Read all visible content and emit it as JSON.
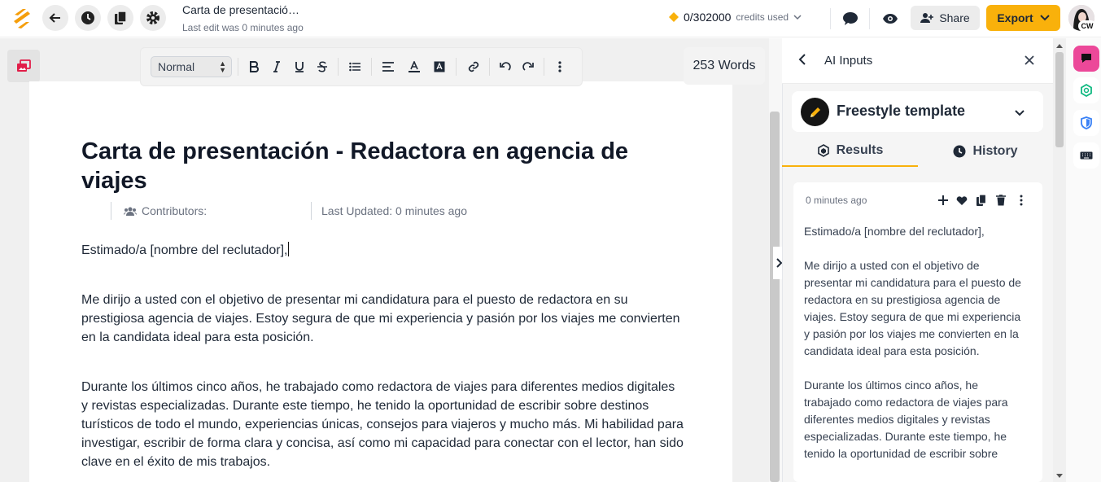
{
  "header": {
    "doc_title": "Carta de presentació…",
    "last_edit": "Last edit was 0 minutes ago",
    "credits_value": "0/302000",
    "credits_unit": "credits used",
    "share_label": "Share",
    "export_label": "Export",
    "avatar_initials": "CW"
  },
  "toolbar": {
    "style_value": "Normal",
    "word_count": "253 Words"
  },
  "document": {
    "title": "Carta de presentación - Redactora en agencia de viajes",
    "contributors_label": "Contributors:",
    "last_updated": "Last Updated: 0 minutes ago",
    "paragraphs": [
      "Estimado/a [nombre del reclutador],",
      "Me dirijo a usted con el objetivo de presentar mi candidatura para el puesto de redactora en su prestigiosa agencia de viajes. Estoy segura de que mi experiencia y pasión por los viajes me convierten en la candidata ideal para esta posición.",
      "Durante los últimos cinco años, he trabajado como redactora de viajes para diferentes medios digitales y revistas especializadas. Durante este tiempo, he tenido la oportunidad de escribir sobre destinos turísticos de todo el mundo, experiencias únicas, consejos para viajeros y mucho más. Mi habilidad para investigar, escribir de forma clara y concisa, así como mi capacidad para conectar con el lector, han sido clave en el éxito de mis trabajos."
    ]
  },
  "panel": {
    "title": "AI Inputs",
    "template_name": "Freestyle template",
    "tab_results": "Results",
    "tab_history": "History",
    "result_time": "0 minutes ago",
    "result_paragraphs": [
      "Estimado/a [nombre del reclutador],",
      "Me dirijo a usted con el objetivo de presentar mi candidatura para el puesto de redactora en su prestigiosa agencia de viajes. Estoy segura de que mi experiencia y pasión por los viajes me convierten en la candidata ideal para esta posición.",
      "Durante los últimos cinco años, he trabajado como redactora de viajes para diferentes medios digitales y revistas especializadas. Durante este tiempo, he tenido la oportunidad de escribir sobre"
    ]
  },
  "colors": {
    "accent": "#f9b10b",
    "logo": "#f59e0b",
    "rail_pink": "#ec4899",
    "rail_green": "#10b981",
    "rail_blue": "#3b82f6"
  }
}
